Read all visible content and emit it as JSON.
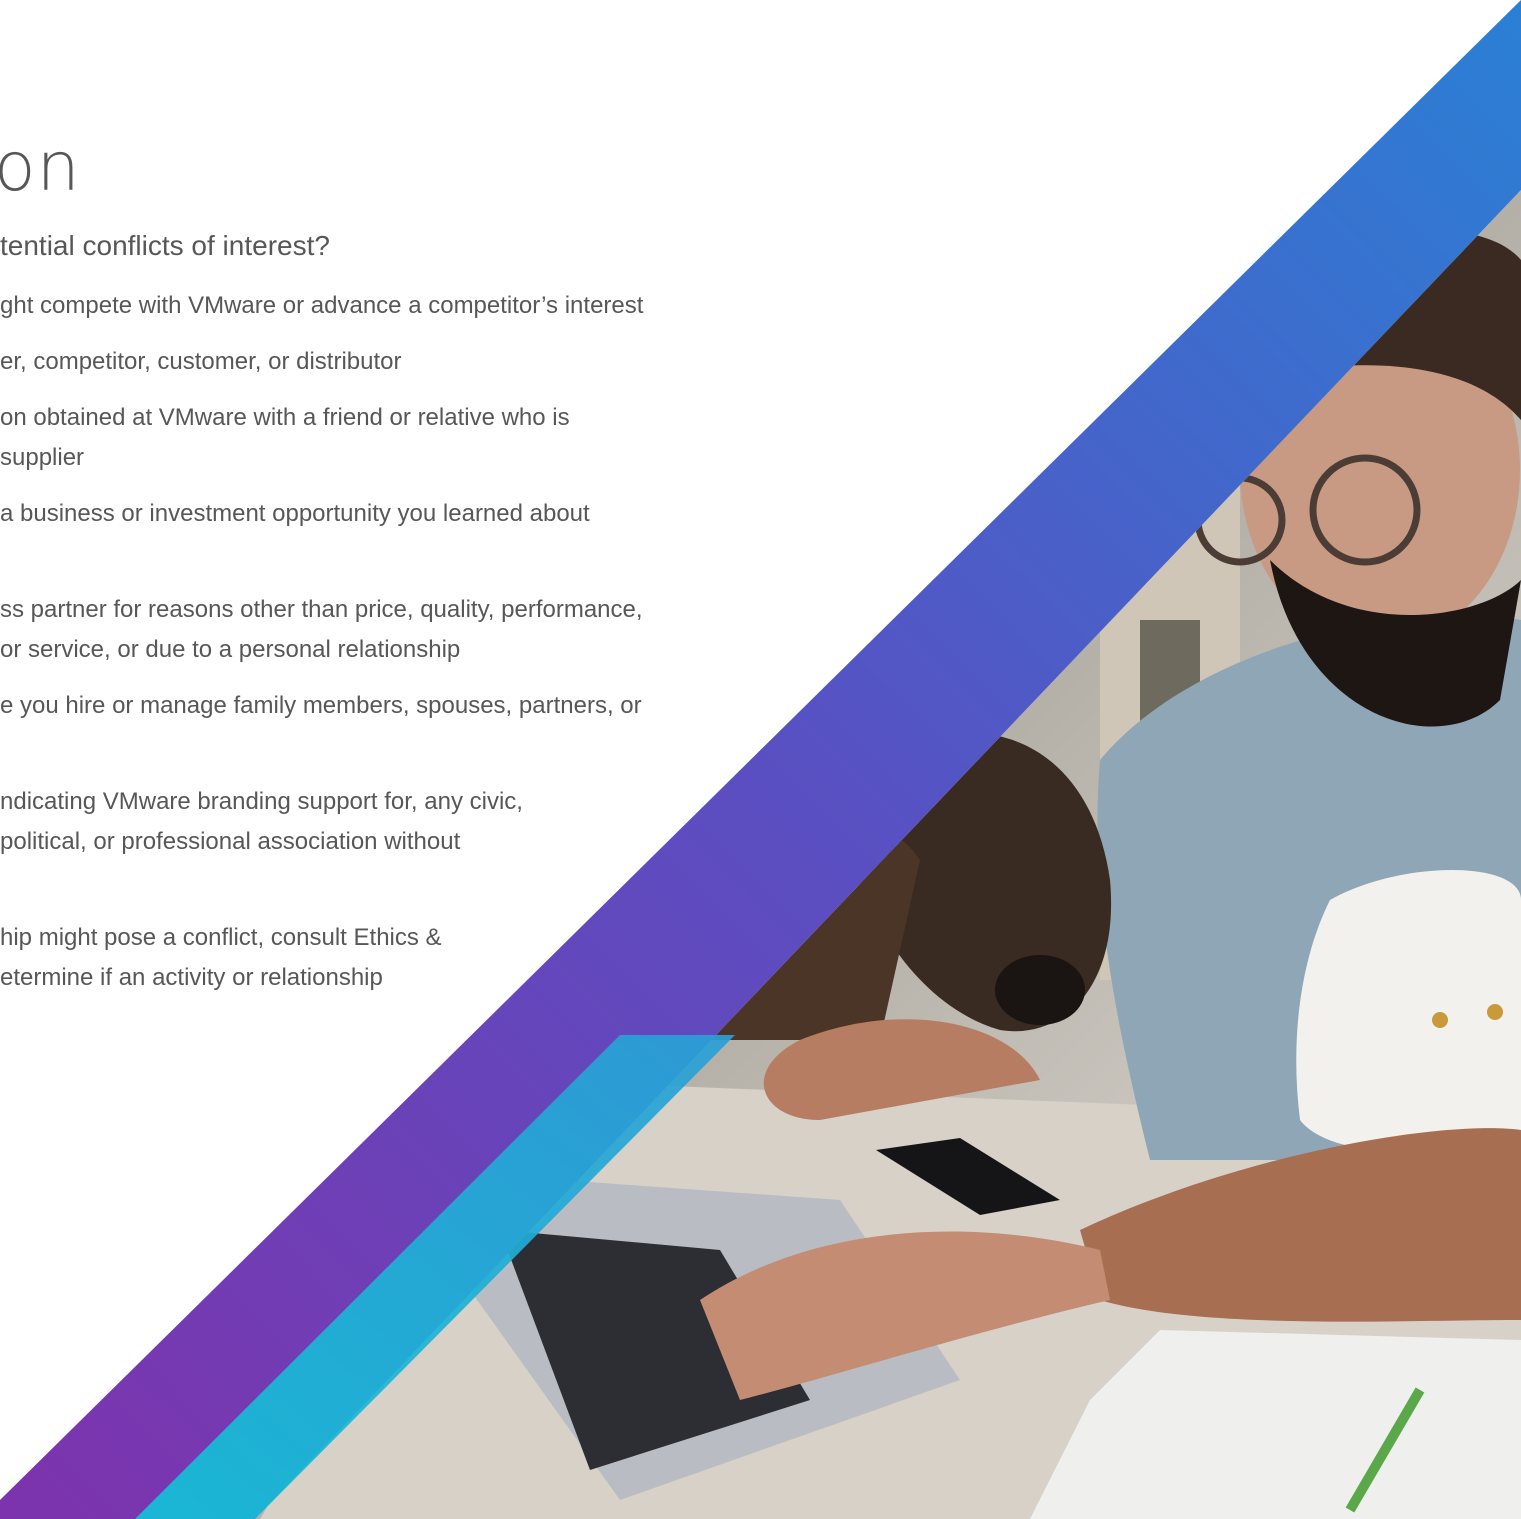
{
  "heading": {
    "title": "on"
  },
  "question": "tential conflicts of interest?",
  "items": [
    {
      "lines": [
        "ght compete with VMware or advance a competitor’s interest"
      ]
    },
    {
      "lines": [
        "er, competitor, customer, or distributor"
      ]
    },
    {
      "lines": [
        "on obtained at VMware with a friend or relative who is",
        "supplier"
      ]
    },
    {
      "lines": [
        " a business or investment opportunity you learned about"
      ]
    },
    {
      "lines": [
        "ss partner for reasons other than price, quality, performance,",
        "or service, or due to a personal relationship"
      ]
    },
    {
      "lines": [
        "e you hire or manage family members, spouses, partners, or"
      ]
    },
    {
      "lines": [
        "ndicating VMware branding support for, any civic,",
        "political, or professional association without"
      ]
    },
    {
      "lines": [
        "hip might pose a conflict, consult Ethics &",
        "etermine if an activity or relationship"
      ]
    }
  ],
  "colors": {
    "banner_top": "#2a7fd4",
    "banner_mid": "#5a4fc2",
    "banner_bottom": "#7a35b0",
    "accent_teal": "#16b9d6",
    "text": "#575757"
  },
  "photo": {
    "subject": "man-with-laptop-dog-and-cat-photo"
  }
}
